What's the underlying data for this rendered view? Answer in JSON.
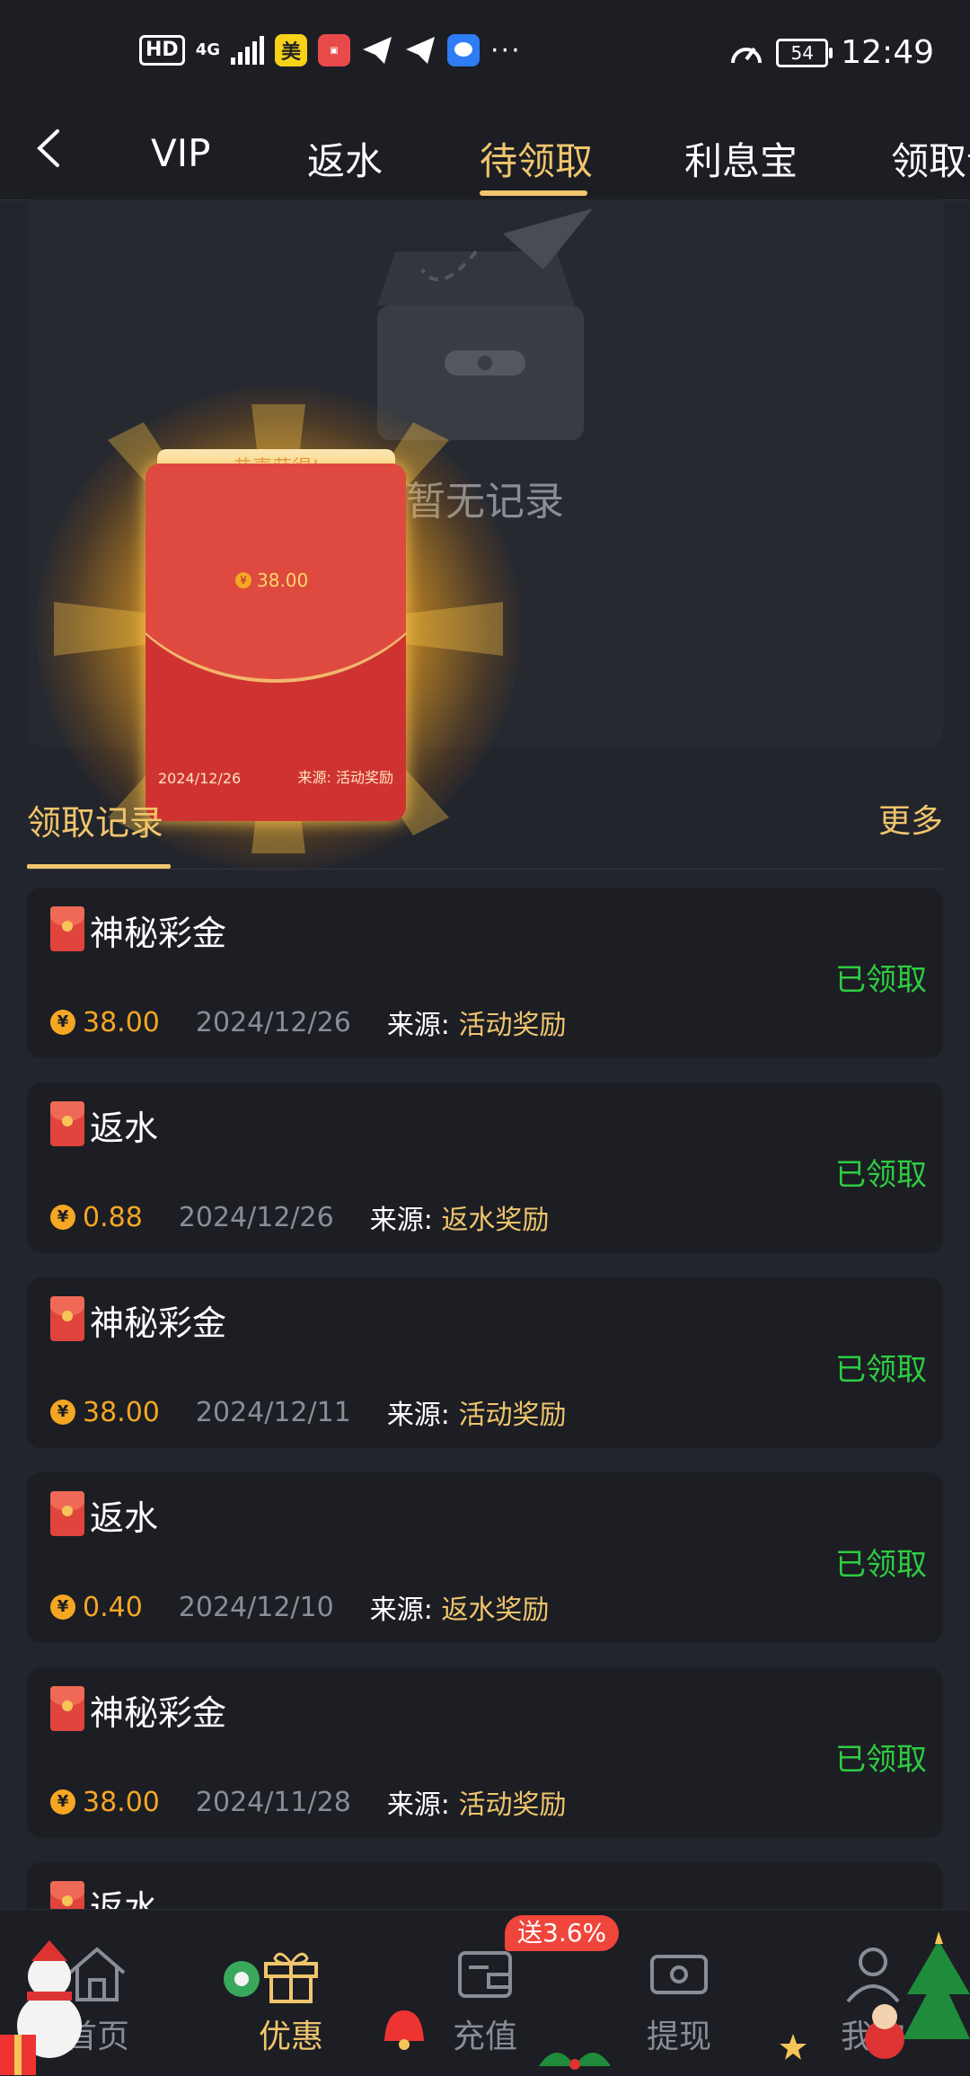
{
  "status_bar": {
    "hd": "HD",
    "network": "4G",
    "app_badge": "美",
    "time": "12:49",
    "battery": "54"
  },
  "tabs": [
    {
      "label": "VIP"
    },
    {
      "label": "返水"
    },
    {
      "label": "待领取",
      "active": true
    },
    {
      "label": "利息宝"
    },
    {
      "label": "领取记"
    }
  ],
  "empty_state": {
    "text": "暂无记录"
  },
  "popup": {
    "header": "恭喜获得!",
    "amount": "38.00",
    "date": "2024/12/26",
    "source": "来源: 活动奖励"
  },
  "records_section": {
    "title": "领取记录",
    "more": "更多"
  },
  "records": [
    {
      "name": "神秘彩金",
      "amount": "38.00",
      "date": "2024/12/26",
      "source_label": "来源:",
      "source": "活动奖励",
      "status": "已领取"
    },
    {
      "name": "返水",
      "amount": "0.88",
      "date": "2024/12/26",
      "source_label": "来源:",
      "source": "返水奖励",
      "status": "已领取"
    },
    {
      "name": "神秘彩金",
      "amount": "38.00",
      "date": "2024/12/11",
      "source_label": "来源:",
      "source": "活动奖励",
      "status": "已领取"
    },
    {
      "name": "返水",
      "amount": "0.40",
      "date": "2024/12/10",
      "source_label": "来源:",
      "source": "返水奖励",
      "status": "已领取"
    },
    {
      "name": "神秘彩金",
      "amount": "38.00",
      "date": "2024/11/28",
      "source_label": "来源:",
      "source": "活动奖励",
      "status": "已领取"
    },
    {
      "name": "返水",
      "amount": "",
      "date": "",
      "source_label": "",
      "source": "",
      "status": ""
    }
  ],
  "bottom_nav": [
    {
      "label": "首页",
      "icon": "home-icon"
    },
    {
      "label": "优惠",
      "icon": "gift-icon",
      "active": true
    },
    {
      "label": "充值",
      "icon": "wallet-icon"
    },
    {
      "label": "提现",
      "icon": "withdraw-icon"
    },
    {
      "label": "我的",
      "icon": "user-icon"
    }
  ],
  "recharge_badge": "送3.6%",
  "colors": {
    "background": "#23252d",
    "card": "#1c1e24",
    "accent_gold": "#f0c56c",
    "amount_orange": "#f5a623",
    "status_green": "#2ecc40",
    "envelope_red": "#cf3331"
  }
}
